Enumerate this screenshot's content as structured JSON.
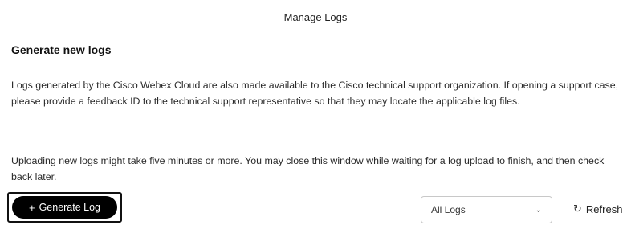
{
  "dialog": {
    "title": "Manage Logs"
  },
  "section": {
    "heading": "Generate new logs",
    "paragraph1": "Logs generated by the Cisco Webex Cloud are also made available to the Cisco technical support organization. If opening a support case, please provide a feedback ID to the technical support representative so that they may locate the applicable log files.",
    "paragraph2": "Uploading new logs might take five minutes or more. You may close this window while waiting for a log upload to finish, and then check back later."
  },
  "actions": {
    "generate_label": "Generate Log",
    "generate_icon": "plus-icon",
    "log_filter": {
      "selected": "All Logs",
      "icon": "chevron-down-icon"
    },
    "refresh_label": "Refresh",
    "refresh_icon": "refresh-icon"
  }
}
